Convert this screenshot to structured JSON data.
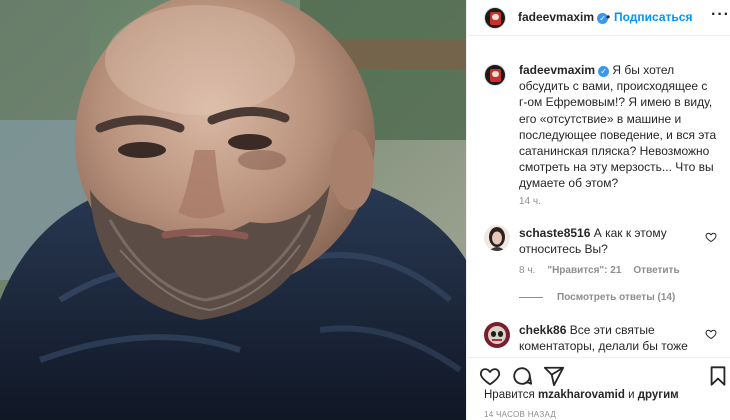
{
  "post": {
    "image_alt": "selfie of a bald bearded man in a dark puffer jacket"
  },
  "header": {
    "username": "fadeevmaxim",
    "verified_badge": "✓",
    "separator": "•",
    "follow_label": "Подписаться",
    "more_label": "···"
  },
  "caption": {
    "username": "fadeevmaxim",
    "text": "Я бы хотел обсудить с вами, происходящее с г-ом Ефремовым!? Я имею в виду, его «отсутствие» в машине и последующее поведение, и вся эта сатанинская пляска? Невозможно смотреть на эту мерзость... Что вы думаете об этом?",
    "time": "14 ч."
  },
  "comments": [
    {
      "username": "schaste8516",
      "text": "А как к этому относитесь Вы?",
      "time": "8 ч.",
      "likes": "\"Нравится\": 21",
      "reply_label": "Ответить",
      "view_replies": "Посмотреть ответы (14)"
    },
    {
      "username": "chekk86",
      "text": "Все эти святые коментаторы, делали бы тоже"
    }
  ],
  "actions": {
    "icons": [
      "heart-icon",
      "comment-icon",
      "share-icon",
      "bookmark-icon"
    ]
  },
  "likes": {
    "prefix": "Нравится",
    "user": "mzakharovamid",
    "middle": "и",
    "others": "другим"
  },
  "posted": "14 ЧАСОВ НАЗАД",
  "colors": {
    "link": "#0095f6",
    "verified": "#3897f0",
    "muted": "#8e8e8e"
  }
}
